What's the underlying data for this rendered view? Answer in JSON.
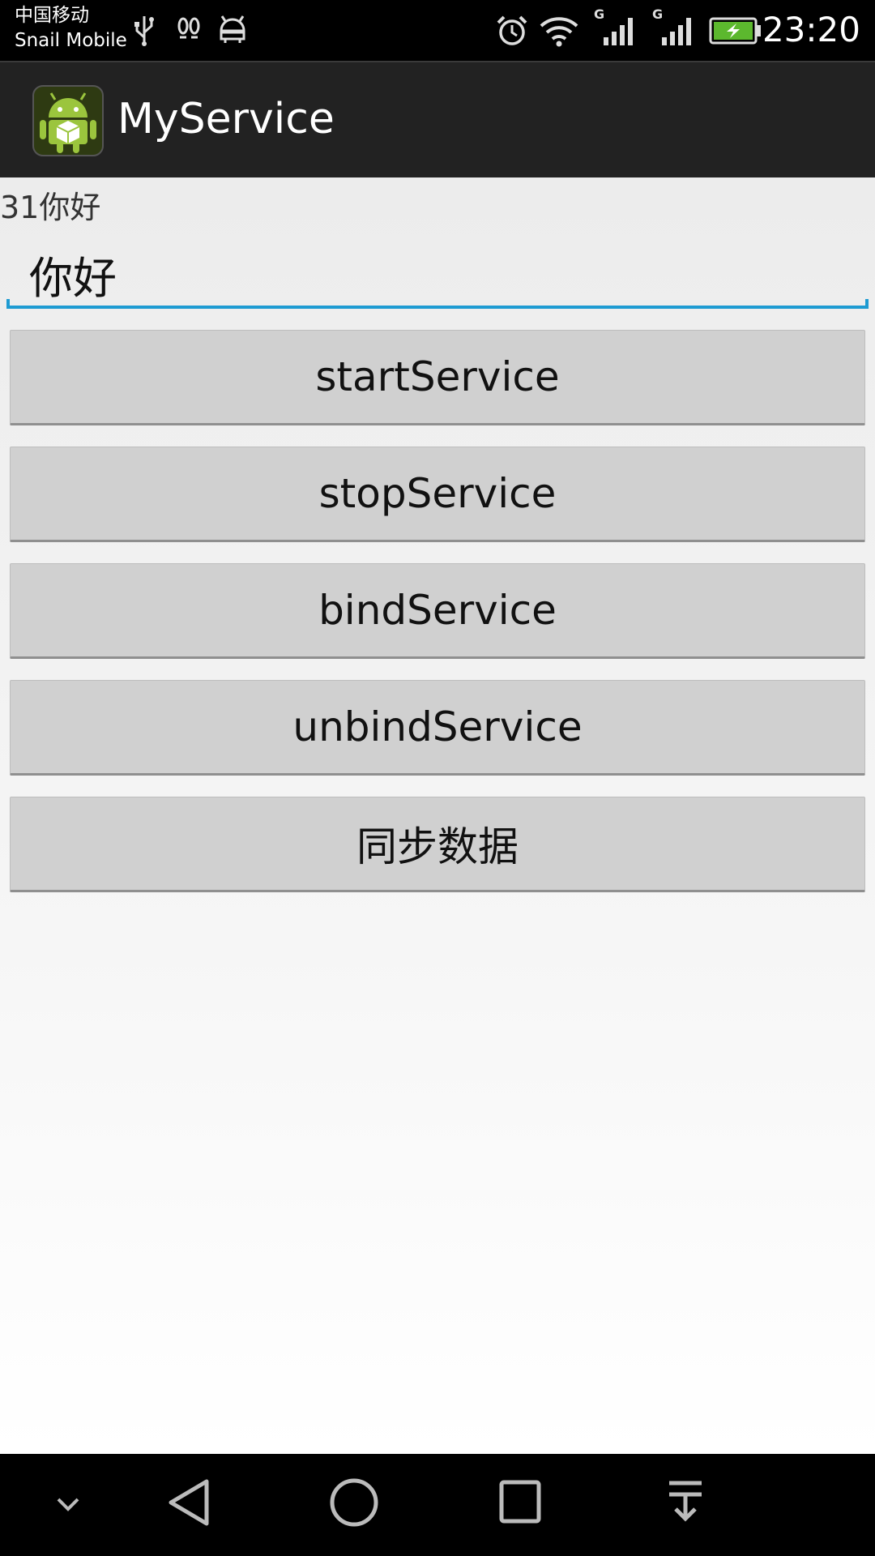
{
  "status_bar": {
    "carrier_line1": "中国移动",
    "carrier_line2": "Snail Mobile",
    "network_label_1": "G",
    "network_label_2": "G",
    "time": "23:20",
    "icons": [
      "usb-icon",
      "footprints-icon",
      "android-debug-icon",
      "alarm-icon",
      "wifi-icon",
      "signal-icon",
      "signal-icon",
      "battery-charging-icon"
    ]
  },
  "action_bar": {
    "app_icon": "android-app-icon",
    "title": "MyService"
  },
  "main": {
    "label": "31你好",
    "input_value": "你好",
    "buttons": [
      "startService",
      "stopService",
      "bindService",
      "unbindService",
      "同步数据"
    ]
  },
  "nav_bar": {
    "icons": [
      "hide-nav-icon",
      "back-icon",
      "home-icon",
      "recents-icon",
      "notification-pull-icon"
    ]
  },
  "colors": {
    "accent": "#1e9bd2",
    "action_bar_bg": "#222222",
    "button_bg": "#d0d0d0",
    "android_green": "#9bc53d"
  }
}
